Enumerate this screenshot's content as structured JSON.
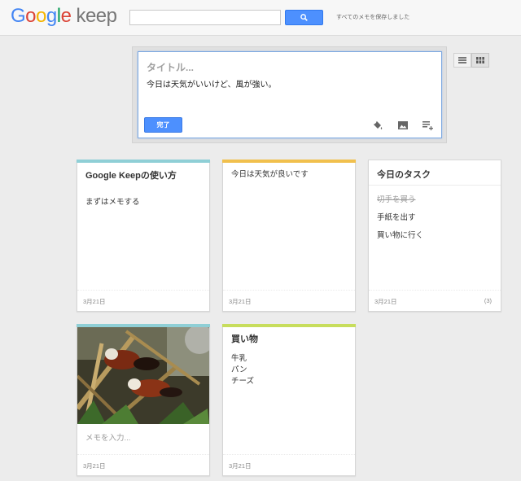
{
  "header": {
    "logo_google": "Google",
    "logo_keep": "keep",
    "search_value": "",
    "save_status": "すべてのメモを保存しました"
  },
  "view_toggle": {
    "list_icon": "list-view-icon",
    "grid_icon": "grid-view-icon",
    "active": "grid"
  },
  "editor": {
    "title_placeholder": "タイトル...",
    "body": "今日は天気がいいけど、風が強い。",
    "done_label": "完了",
    "tools": [
      "paint-bucket-icon",
      "image-icon",
      "list-add-icon"
    ]
  },
  "notes": [
    {
      "title": "Google Keepの使い方",
      "body": "まずはメモする",
      "date": "3月21日",
      "color": "#8fcfd6"
    },
    {
      "body": "今日は天気が良いです",
      "date": "3月21日",
      "color": "#f1c04d"
    },
    {
      "title": "今日のタスク",
      "items": [
        {
          "text": "切手を買う",
          "checked": true
        },
        {
          "text": "手紙を出す",
          "checked": false
        },
        {
          "text": "買い物に行く",
          "checked": false
        }
      ],
      "date": "3月21日",
      "count": "(3)",
      "color": "#ffffff"
    },
    {
      "placeholder": "メモを入力...",
      "date": "3月21日",
      "color": "#8fcfd6",
      "has_photo": true
    },
    {
      "title": "買い物",
      "items": [
        "牛乳",
        "パン",
        "チーズ"
      ],
      "date": "3月21日",
      "color": "#c7dd5c"
    }
  ],
  "colors": {
    "accent": "#4d90fe",
    "background": "#ececec"
  }
}
